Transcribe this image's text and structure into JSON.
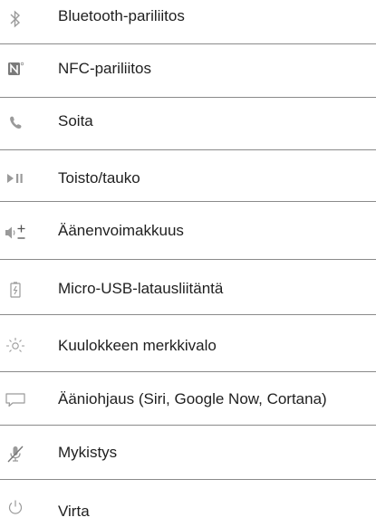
{
  "legend": {
    "items": [
      {
        "icon": "bluetooth-icon",
        "label": "Bluetooth-pariliitos"
      },
      {
        "icon": "nfc-icon",
        "label": "NFC-pariliitos"
      },
      {
        "icon": "phone-icon",
        "label": "Soita"
      },
      {
        "icon": "play-pause-icon",
        "label": "Toisto/tauko"
      },
      {
        "icon": "volume-icon",
        "label": "Äänenvoimakkuus"
      },
      {
        "icon": "battery-charging-icon",
        "label": "Micro-USB-latausliitäntä"
      },
      {
        "icon": "indicator-light-icon",
        "label": "Kuulokkeen merkkivalo"
      },
      {
        "icon": "speech-bubble-icon",
        "label": "Ääniohjaus (Siri, Google Now, Cortana)"
      },
      {
        "icon": "mute-icon",
        "label": "Mykistys"
      },
      {
        "icon": "power-icon",
        "label": "Virta"
      }
    ]
  },
  "colors": {
    "icon": "#9a9a9a",
    "text": "#1f1f1f",
    "divider": "#8a8a8a"
  }
}
